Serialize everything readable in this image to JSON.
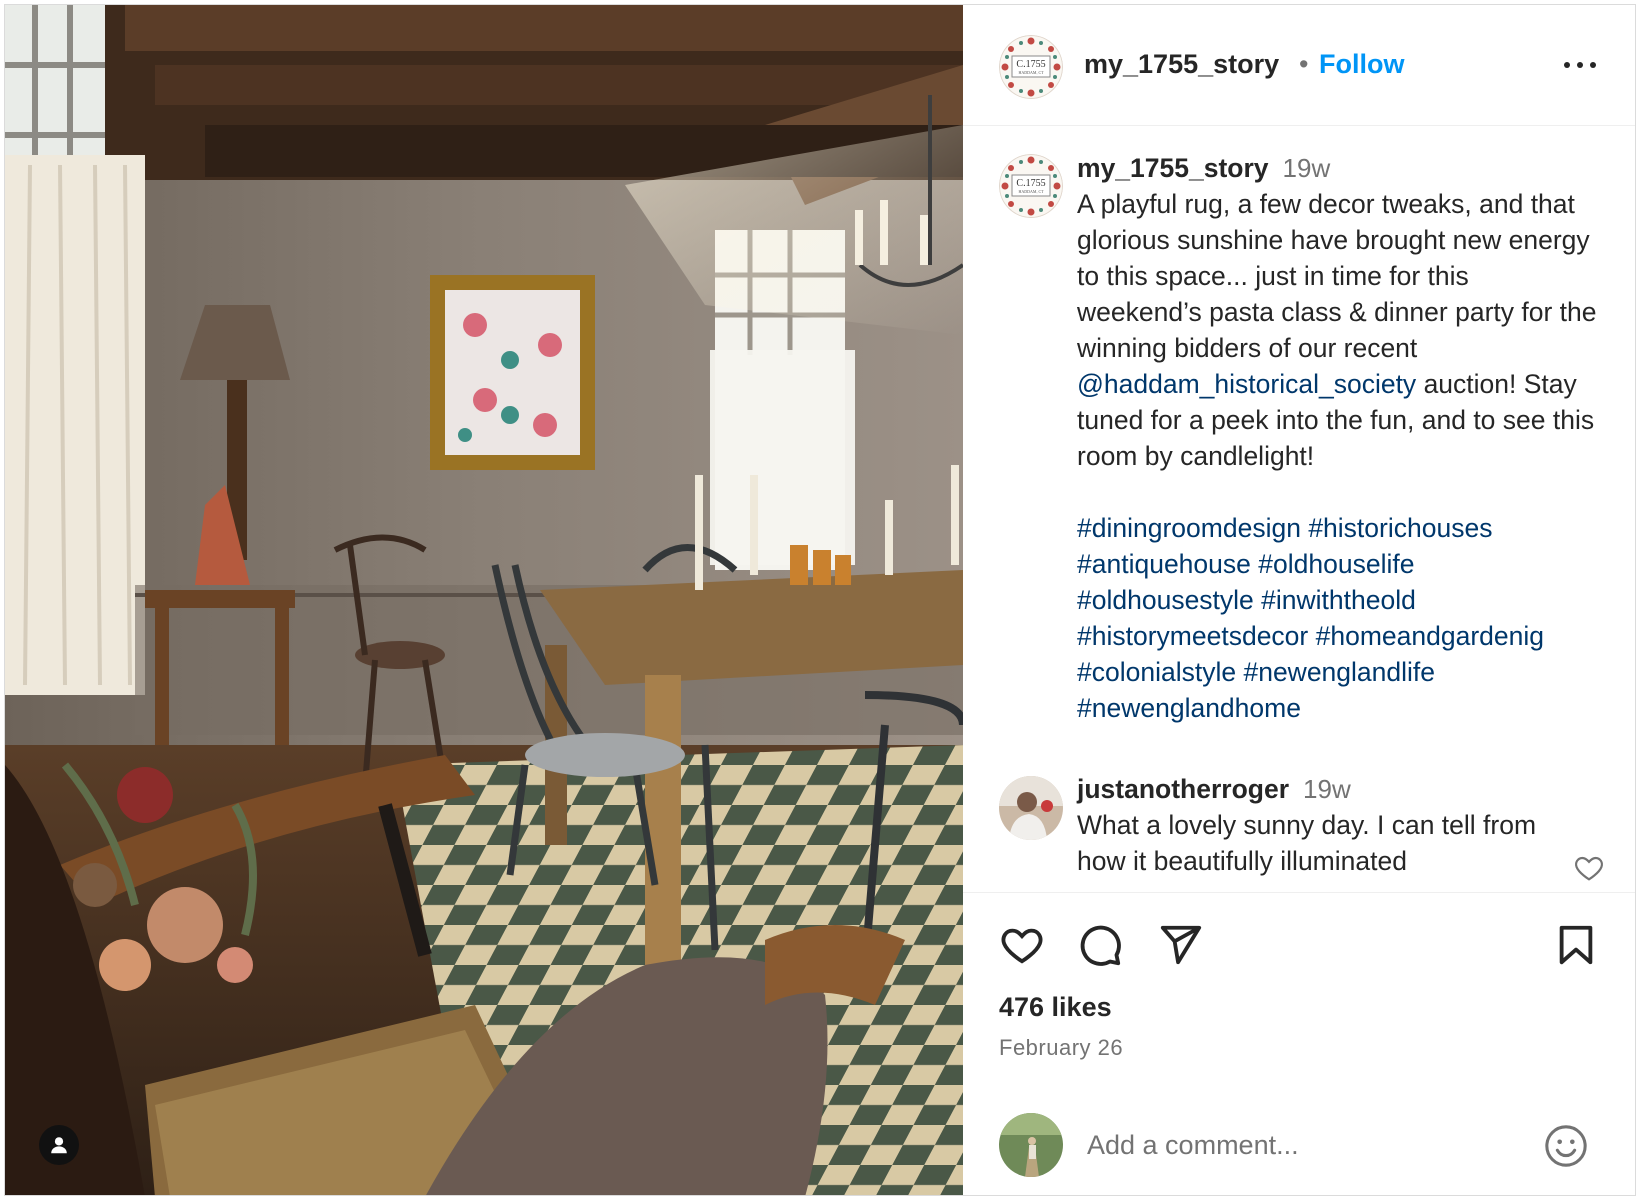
{
  "post": {
    "username": "my_1755_story",
    "separator": "•",
    "follow_label": "Follow",
    "more_icon": "more-horizontal-icon"
  },
  "caption": {
    "username": "my_1755_story",
    "time": "19w",
    "text_before": "A playful rug, a few decor tweaks, and that glorious sunshine have brought new energy to this space... just in time for this weekend’s pasta class & dinner party for the winning bidders of our recent",
    "mention": "@haddam_historical_society",
    "text_after": "auction! Stay tuned for a peek into the fun, and to see this room by candlelight!",
    "hashtags": [
      "#diningroomdesign",
      "#historichouses",
      "#antiquehouse",
      "#oldhouselife",
      "#oldhousestyle",
      "#inwiththeold",
      "#historymeetsdecor",
      "#homeandgardenig",
      "#colonialstyle",
      "#newenglandlife",
      "#newenglandhome"
    ]
  },
  "comment": {
    "username": "justanotherroger",
    "time": "19w",
    "text": "What a lovely sunny day. I can tell from how it beautifully illuminated"
  },
  "stats": {
    "likes": "476 likes",
    "date": "February 26"
  },
  "composer": {
    "placeholder": "Add a comment..."
  },
  "avatar_badge": {
    "line1": "C.1755",
    "line2": "HADDAM, CT"
  },
  "colors": {
    "link_blue": "#0095f6",
    "mention_blue": "#00376b",
    "muted": "#737373",
    "text": "#262626"
  }
}
